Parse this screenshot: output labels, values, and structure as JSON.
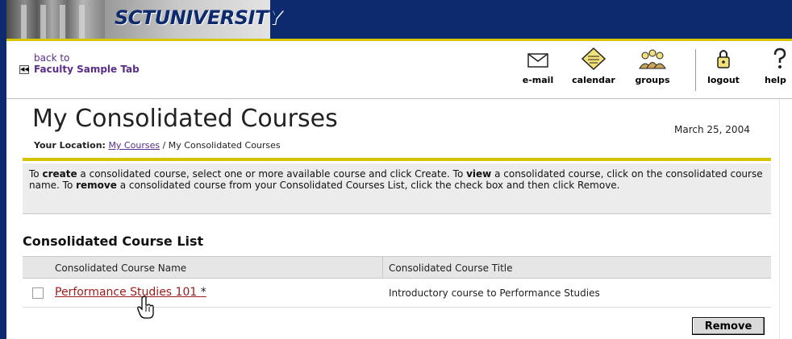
{
  "banner": {
    "logo_text": "SCTUNIVERSITY"
  },
  "nav": {
    "back_line1": "back to",
    "back_line2": "Faculty Sample Tab",
    "tools": [
      {
        "label": "e-mail",
        "icon": "envelope-icon"
      },
      {
        "label": "calendar",
        "icon": "calendar-icon"
      },
      {
        "label": "groups",
        "icon": "groups-icon"
      },
      {
        "label": "logout",
        "icon": "logout-icon"
      },
      {
        "label": "help",
        "icon": "help-icon"
      }
    ]
  },
  "page": {
    "title": "My Consolidated Courses",
    "date": "March 25, 2004",
    "location_label": "Your Location:",
    "location_link": "My Courses",
    "location_current": "/ My Consolidated Courses"
  },
  "info": {
    "part1": "To ",
    "create": "create",
    "part2": " a consolidated course, select one or more available course and click Create. To ",
    "view": "view",
    "part3": " a consolidated course, click on the consolidated course name. To ",
    "remove": "remove",
    "part4": " a consolidated course from your Consolidated Courses List, click the check box and then click Remove."
  },
  "list": {
    "section_title": "Consolidated Course List",
    "col_name": "Consolidated Course Name",
    "col_title": "Consolidated Course Title",
    "rows": [
      {
        "name": "Performance Studies 101",
        "marker": "*",
        "title": "Introductory course to Performance Studies"
      }
    ],
    "remove_label": "Remove"
  },
  "colors": {
    "navy": "#0d2a6e",
    "gold": "#d6c400",
    "link_purple": "#5a2d8a",
    "course_red": "#9c1a1a"
  }
}
